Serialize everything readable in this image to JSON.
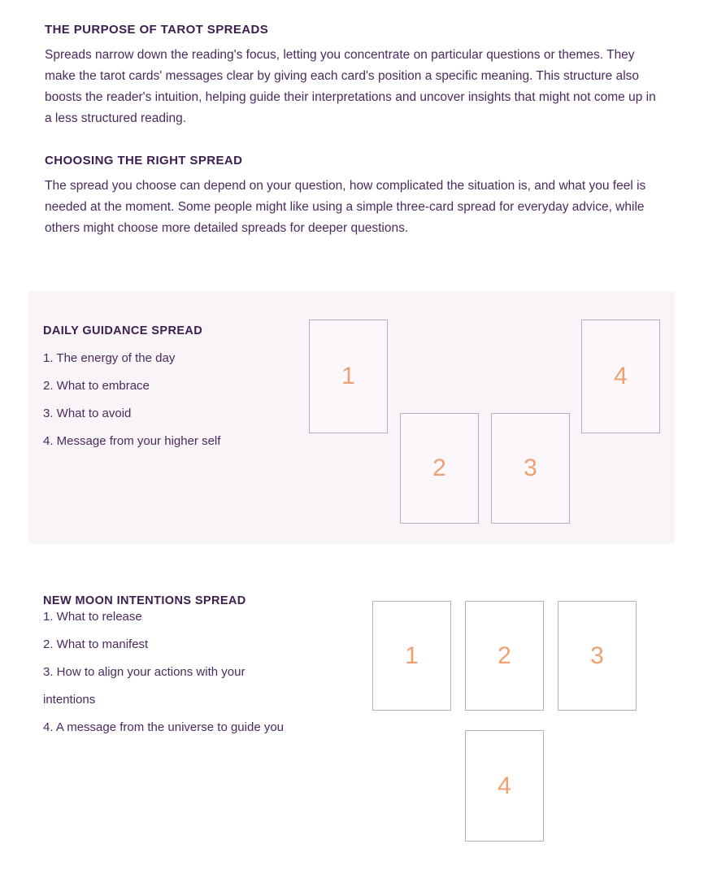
{
  "intro": {
    "sections": [
      {
        "heading": "THE PURPOSE OF TAROT SPREADS",
        "paragraph": "Spreads narrow down the reading's focus, letting you concentrate on particular questions or themes. They make the tarot cards' messages clear by giving each card's position a specific meaning. This structure also boosts the reader's intuition, helping guide their interpretations and uncover insights that might not come up in a less structured reading."
      },
      {
        "heading": "CHOOSING THE RIGHT SPREAD",
        "paragraph": "The spread you choose can depend on your question, how complicated the situation is, and what you feel is needed at the moment. Some people might like using a simple three-card spread for everyday advice, while others might choose more detailed spreads for deeper questions."
      }
    ]
  },
  "spreads": [
    {
      "title": "DAILY GUIDANCE SPREAD",
      "positions": [
        "1. The energy of the day",
        "2. What to embrace",
        "3. What to avoid",
        "4. Message from your higher self"
      ],
      "cards": [
        {
          "number": "1"
        },
        {
          "number": "2"
        },
        {
          "number": "3"
        },
        {
          "number": "4"
        }
      ]
    },
    {
      "title": "NEW MOON INTENTIONS SPREAD",
      "positions": [
        "1. What to release",
        "2. What to manifest",
        "3. How to align your actions with your intentions",
        "4. A message from the universe to guide you"
      ],
      "cards": [
        {
          "number": "1"
        },
        {
          "number": "2"
        },
        {
          "number": "3"
        },
        {
          "number": "4"
        }
      ]
    }
  ],
  "colors": {
    "heading_purple": "#3b1e4e",
    "body_purple": "#4a2b5c",
    "card_border": "#b8aec4",
    "card_number_orange": "#f0a070",
    "panel_background": "#f9f4f8",
    "page_background": "#ffffff"
  }
}
